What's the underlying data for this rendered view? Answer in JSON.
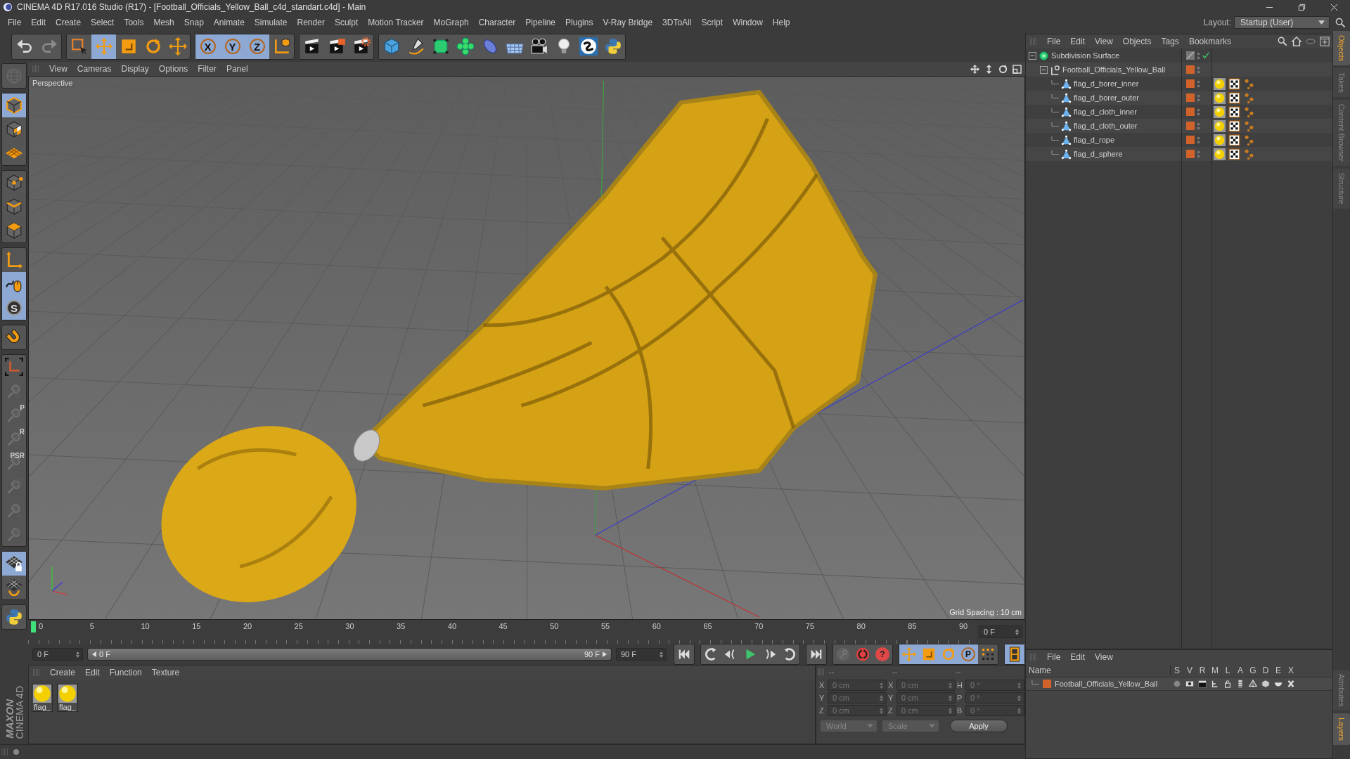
{
  "window": {
    "title": "CINEMA 4D R17.016 Studio (R17) - [Football_Officials_Yellow_Ball_c4d_standart.c4d] - Main"
  },
  "menu": [
    "File",
    "Edit",
    "Create",
    "Select",
    "Tools",
    "Mesh",
    "Snap",
    "Animate",
    "Simulate",
    "Render",
    "Sculpt",
    "Motion Tracker",
    "MoGraph",
    "Character",
    "Pipeline",
    "Plugins",
    "V-Ray Bridge",
    "3DToAll",
    "Script",
    "Window",
    "Help"
  ],
  "layout": {
    "label": "Layout:",
    "value": "Startup (User)"
  },
  "toolbar": [
    [
      {
        "kind": "undo",
        "selected": false,
        "disabled": false
      },
      {
        "kind": "redo",
        "selected": false,
        "disabled": true
      }
    ],
    [
      {
        "kind": "select-rect",
        "selected": false,
        "disabled": false
      },
      {
        "kind": "move",
        "selected": true,
        "disabled": false
      },
      {
        "kind": "scale",
        "selected": false,
        "disabled": false
      },
      {
        "kind": "rotate",
        "selected": false,
        "disabled": false
      },
      {
        "kind": "move-plus",
        "selected": false,
        "disabled": false
      }
    ],
    [
      {
        "kind": "axis",
        "glyph": "X",
        "selected": true,
        "disabled": false
      },
      {
        "kind": "axis",
        "glyph": "Y",
        "selected": true,
        "disabled": false
      },
      {
        "kind": "axis",
        "glyph": "Z",
        "selected": true,
        "disabled": false
      },
      {
        "kind": "coord",
        "selected": false,
        "disabled": false
      }
    ],
    [
      {
        "kind": "render-view",
        "selected": false,
        "disabled": false
      },
      {
        "kind": "render-picture",
        "selected": false,
        "disabled": false
      },
      {
        "kind": "render-settings",
        "selected": false,
        "disabled": false
      }
    ],
    [
      {
        "kind": "cube",
        "selected": false,
        "disabled": false
      },
      {
        "kind": "pen",
        "selected": false,
        "disabled": false
      },
      {
        "kind": "subdivide",
        "selected": false,
        "disabled": false
      },
      {
        "kind": "cloner",
        "selected": false,
        "disabled": false
      },
      {
        "kind": "deformer",
        "selected": false,
        "disabled": false
      },
      {
        "kind": "floor",
        "selected": false,
        "disabled": false
      },
      {
        "kind": "camera",
        "selected": false,
        "disabled": false
      },
      {
        "kind": "light",
        "selected": false,
        "disabled": false
      },
      {
        "kind": "vray",
        "selected": false,
        "disabled": false
      },
      {
        "kind": "python",
        "selected": false,
        "disabled": false
      }
    ]
  ],
  "left_tools": [
    [
      {
        "kind": "globe",
        "selected": false,
        "disabled": true
      }
    ],
    [
      {
        "kind": "model",
        "selected": true,
        "disabled": false
      },
      {
        "kind": "texture",
        "selected": false,
        "disabled": false
      },
      {
        "kind": "workplane",
        "selected": false,
        "disabled": false
      }
    ],
    [
      {
        "kind": "points",
        "selected": false,
        "disabled": false
      },
      {
        "kind": "edges",
        "selected": false,
        "disabled": false
      },
      {
        "kind": "polygons",
        "selected": false,
        "disabled": false
      }
    ],
    [
      {
        "kind": "axis-tool",
        "selected": false,
        "disabled": false
      },
      {
        "kind": "tweak",
        "selected": true,
        "disabled": false
      },
      {
        "kind": "soft",
        "glyph": "S",
        "selected": true,
        "disabled": false
      }
    ],
    [
      {
        "kind": "magnet",
        "selected": false,
        "disabled": false
      }
    ],
    [
      {
        "kind": "axis-corner",
        "selected": false,
        "disabled": false
      },
      {
        "kind": "ghost-plus",
        "selected": false,
        "disabled": true
      },
      {
        "kind": "ghost-p",
        "glyph": "P",
        "selected": false,
        "disabled": true
      },
      {
        "kind": "ghost-r",
        "glyph": "R",
        "selected": false,
        "disabled": true
      },
      {
        "kind": "ghost-psr",
        "glyph": "PSR",
        "selected": false,
        "disabled": true
      },
      {
        "kind": "ghost-target",
        "selected": false,
        "disabled": true
      },
      {
        "kind": "ghost-rotate",
        "selected": false,
        "disabled": true
      },
      {
        "kind": "ghost-sweep",
        "selected": false,
        "disabled": true
      }
    ],
    [
      {
        "kind": "grid-lock",
        "selected": true,
        "disabled": false
      },
      {
        "kind": "grid-rotate",
        "selected": false,
        "disabled": false
      }
    ],
    [
      {
        "kind": "python",
        "selected": false,
        "disabled": false
      }
    ]
  ],
  "brand": {
    "line1": "MAXON",
    "line2": "CINEMA 4D"
  },
  "viewport": {
    "menu": [
      "View",
      "Cameras",
      "Display",
      "Options",
      "Filter",
      "Panel"
    ],
    "camera": "Perspective",
    "grid_spacing": "Grid Spacing : 10 cm"
  },
  "timeline": {
    "ticks": [
      "0",
      "5",
      "10",
      "15",
      "20",
      "25",
      "30",
      "35",
      "40",
      "45",
      "50",
      "55",
      "60",
      "65",
      "70",
      "75",
      "80",
      "85",
      "90"
    ],
    "level": 0,
    "current_frame": "0 F"
  },
  "transport": {
    "start_field": "0 F",
    "range": {
      "start": "0 F",
      "end": "90 F",
      "level": 1
    },
    "end_field": "90 F",
    "buttons": [
      [
        {
          "kind": "first",
          "selected": false,
          "disabled": false
        }
      ],
      [
        {
          "kind": "key-prev",
          "selected": false,
          "disabled": false
        },
        {
          "kind": "prev",
          "selected": false,
          "disabled": false
        },
        {
          "kind": "play",
          "selected": false,
          "disabled": false
        },
        {
          "kind": "next",
          "selected": false,
          "disabled": false
        },
        {
          "kind": "key-next",
          "selected": false,
          "disabled": false
        }
      ],
      [
        {
          "kind": "last",
          "selected": false,
          "disabled": false
        }
      ],
      [
        {
          "kind": "key",
          "selected": false,
          "disabled": true
        },
        {
          "kind": "record",
          "selected": false,
          "disabled": false
        },
        {
          "kind": "help",
          "glyph": "?",
          "selected": false,
          "disabled": false
        }
      ],
      [
        {
          "kind": "move",
          "selected": true,
          "disabled": false
        },
        {
          "kind": "scale",
          "selected": true,
          "disabled": false
        },
        {
          "kind": "rotate",
          "selected": true,
          "disabled": false
        },
        {
          "kind": "param",
          "glyph": "P",
          "selected": true,
          "disabled": false
        },
        {
          "kind": "dots",
          "selected": false,
          "disabled": false
        }
      ],
      [
        {
          "kind": "film",
          "selected": true,
          "disabled": false
        }
      ]
    ]
  },
  "material_manager": {
    "menu": [
      "Create",
      "Edit",
      "Function",
      "Texture"
    ],
    "materials": [
      {
        "name": "flag_"
      },
      {
        "name": "flag_"
      }
    ]
  },
  "coordinates": {
    "headers": [
      "--",
      "--",
      "--"
    ],
    "rows": [
      {
        "labels": [
          "X",
          "X",
          "H"
        ],
        "values": [
          "0 cm",
          "0 cm",
          "0 °"
        ]
      },
      {
        "labels": [
          "Y",
          "Y",
          "P"
        ],
        "values": [
          "0 cm",
          "0 cm",
          "0 °"
        ]
      },
      {
        "labels": [
          "Z",
          "Z",
          "B"
        ],
        "values": [
          "0 cm",
          "0 cm",
          "0 °"
        ]
      }
    ],
    "space": "World",
    "mode": "Scale",
    "apply": "Apply"
  },
  "object_manager": {
    "menu": [
      "File",
      "Edit",
      "View",
      "Objects",
      "Tags",
      "Bookmarks"
    ],
    "objects": [
      {
        "name": "Subdivision Surface",
        "kind": "subdivision",
        "expanded": true,
        "enabled": true,
        "children": [
          {
            "name": "Football_Officials_Yellow_Ball",
            "kind": "null",
            "expanded": true,
            "color": "#d0622a",
            "children": [
              {
                "name": "flag_d_borer_inner",
                "kind": "polygon",
                "color": "#d0622a",
                "tags": [
                  {
                    "kind": "material"
                  },
                  {
                    "kind": "texture"
                  },
                  {
                    "kind": "dots"
                  }
                ]
              },
              {
                "name": "flag_d_borer_outer",
                "kind": "polygon",
                "color": "#d0622a",
                "tags": [
                  {
                    "kind": "material"
                  },
                  {
                    "kind": "texture"
                  },
                  {
                    "kind": "dots"
                  }
                ]
              },
              {
                "name": "flag_d_cloth_inner",
                "kind": "polygon",
                "color": "#d0622a",
                "tags": [
                  {
                    "kind": "material"
                  },
                  {
                    "kind": "texture"
                  },
                  {
                    "kind": "dots"
                  }
                ]
              },
              {
                "name": "flag_d_cloth_outer",
                "kind": "polygon",
                "color": "#d0622a",
                "tags": [
                  {
                    "kind": "material"
                  },
                  {
                    "kind": "texture"
                  },
                  {
                    "kind": "dots"
                  }
                ]
              },
              {
                "name": "flag_d_rope",
                "kind": "polygon",
                "color": "#d0622a",
                "tags": [
                  {
                    "kind": "material"
                  },
                  {
                    "kind": "texture"
                  },
                  {
                    "kind": "dots"
                  }
                ]
              },
              {
                "name": "flag_d_sphere",
                "kind": "polygon",
                "color": "#d0622a",
                "tags": [
                  {
                    "kind": "material"
                  },
                  {
                    "kind": "texture"
                  },
                  {
                    "kind": "dots"
                  }
                ]
              }
            ]
          }
        ]
      }
    ]
  },
  "layer_manager": {
    "menu": [
      "File",
      "Edit",
      "View"
    ],
    "columns": [
      "Name",
      "S",
      "V",
      "R",
      "M",
      "L",
      "A",
      "G",
      "D",
      "E",
      "X"
    ],
    "layers": [
      {
        "name": "Football_Officials_Yellow_Ball",
        "color": "#d0622a"
      }
    ]
  },
  "side_tabs": [
    {
      "label": "Objects",
      "selected": true
    },
    {
      "label": "Takes",
      "selected": false
    },
    {
      "label": "Content Browser",
      "selected": false
    },
    {
      "label": "Structure",
      "selected": false
    }
  ],
  "side_tabs_lower": [
    {
      "label": "Attributes",
      "selected": false
    },
    {
      "label": "Layers",
      "selected": true
    }
  ]
}
